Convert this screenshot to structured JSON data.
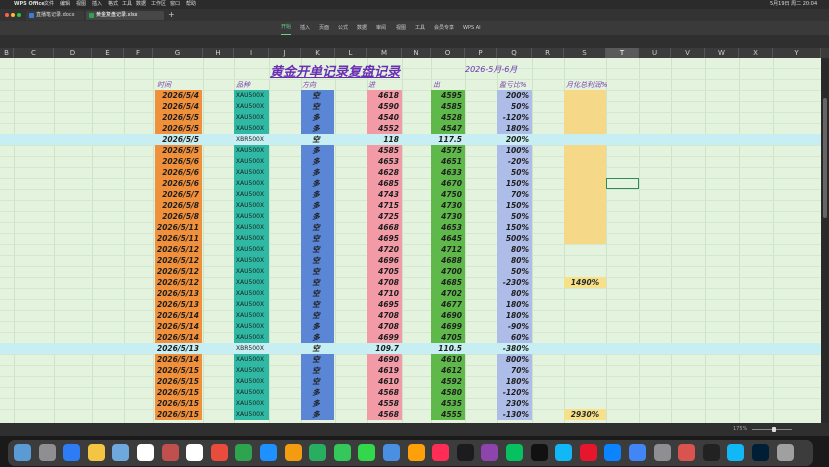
{
  "menubar": {
    "app_name": "WPS Office",
    "items": [
      "文件",
      "编辑",
      "视图",
      "插入",
      "格式",
      "工具",
      "数据",
      "工作区",
      "窗口",
      "帮助"
    ],
    "clock": "5月19日 周二 20:04"
  },
  "tabs": [
    {
      "label": "直播笔记录.docx",
      "color": "#3d7bd9"
    },
    {
      "label": "黄金复盘记录.xlsx",
      "color": "#2ea44f"
    }
  ],
  "ribbon": {
    "items": [
      "开始",
      "插入",
      "页面",
      "公式",
      "数据",
      "审阅",
      "视图",
      "工具",
      "会员专享",
      "WPS AI"
    ],
    "active": "开始"
  },
  "columns": [
    "B",
    "C",
    "D",
    "E",
    "F",
    "G",
    "H",
    "I",
    "J",
    "K",
    "L",
    "M",
    "N",
    "O",
    "P",
    "Q",
    "R",
    "S",
    "T",
    "U",
    "V",
    "W",
    "X",
    "Y"
  ],
  "selected_column": "T",
  "sheet": {
    "title": "黄金开单记录复盘记录",
    "period": "2026-5月-6月",
    "headers": {
      "date": "时间",
      "product": "品种",
      "direction": "方向",
      "entry": "进",
      "exit": "出",
      "profit": "盈亏比%",
      "monthly": "月化总利润%"
    },
    "rows": [
      {
        "date": "2026/5/4",
        "product": "XAU500X",
        "direction": "空",
        "entry": "4618",
        "exit": "4595",
        "profit": "200%"
      },
      {
        "date": "2026/5/4",
        "product": "XAU500X",
        "direction": "空",
        "entry": "4590",
        "exit": "4585",
        "profit": "50%"
      },
      {
        "date": "2026/5/5",
        "product": "XAU500X",
        "direction": "多",
        "entry": "4540",
        "exit": "4528",
        "profit": "-120%"
      },
      {
        "date": "2026/5/5",
        "product": "XAU500X",
        "direction": "多",
        "entry": "4552",
        "exit": "4547",
        "profit": "180%"
      },
      {
        "date": "2026/5/5",
        "product": "XBR500X",
        "direction": "空",
        "entry": "118",
        "exit": "117.5",
        "profit": "200%",
        "special": true
      },
      {
        "date": "2026/5/5",
        "product": "XAU500X",
        "direction": "多",
        "entry": "4585",
        "exit": "4575",
        "profit": "100%"
      },
      {
        "date": "2026/5/6",
        "product": "XAU500X",
        "direction": "多",
        "entry": "4653",
        "exit": "4651",
        "profit": "-20%"
      },
      {
        "date": "2026/5/6",
        "product": "XAU500X",
        "direction": "多",
        "entry": "4628",
        "exit": "4633",
        "profit": "50%"
      },
      {
        "date": "2026/5/6",
        "product": "XAU500X",
        "direction": "多",
        "entry": "4685",
        "exit": "4670",
        "profit": "150%"
      },
      {
        "date": "2026/5/7",
        "product": "XAU500X",
        "direction": "多",
        "entry": "4743",
        "exit": "4750",
        "profit": "70%"
      },
      {
        "date": "2026/5/8",
        "product": "XAU500X",
        "direction": "多",
        "entry": "4715",
        "exit": "4730",
        "profit": "150%"
      },
      {
        "date": "2026/5/8",
        "product": "XAU500X",
        "direction": "多",
        "entry": "4725",
        "exit": "4730",
        "profit": "50%"
      },
      {
        "date": "2026/5/11",
        "product": "XAU500X",
        "direction": "空",
        "entry": "4668",
        "exit": "4653",
        "profit": "150%"
      },
      {
        "date": "2026/5/11",
        "product": "XAU500X",
        "direction": "空",
        "entry": "4695",
        "exit": "4645",
        "profit": "500%"
      },
      {
        "date": "2026/5/12",
        "product": "XAU500X",
        "direction": "空",
        "entry": "4720",
        "exit": "4712",
        "profit": "80%"
      },
      {
        "date": "2026/5/12",
        "product": "XAU500X",
        "direction": "空",
        "entry": "4696",
        "exit": "4688",
        "profit": "80%"
      },
      {
        "date": "2026/5/12",
        "product": "XAU500X",
        "direction": "空",
        "entry": "4705",
        "exit": "4700",
        "profit": "50%"
      },
      {
        "date": "2026/5/12",
        "product": "XAU500X",
        "direction": "空",
        "entry": "4708",
        "exit": "4685",
        "profit": "-230%"
      },
      {
        "date": "2026/5/13",
        "product": "XAU500X",
        "direction": "空",
        "entry": "4710",
        "exit": "4702",
        "profit": "80%"
      },
      {
        "date": "2026/5/13",
        "product": "XAU500X",
        "direction": "空",
        "entry": "4695",
        "exit": "4677",
        "profit": "180%"
      },
      {
        "date": "2026/5/14",
        "product": "XAU500X",
        "direction": "空",
        "entry": "4708",
        "exit": "4690",
        "profit": "180%"
      },
      {
        "date": "2026/5/14",
        "product": "XAU500X",
        "direction": "多",
        "entry": "4708",
        "exit": "4699",
        "profit": "-90%"
      },
      {
        "date": "2026/5/14",
        "product": "XAU500X",
        "direction": "多",
        "entry": "4699",
        "exit": "4705",
        "profit": "60%"
      },
      {
        "date": "2026/5/13",
        "product": "XBR500X",
        "direction": "空",
        "entry": "109.7",
        "exit": "110.5",
        "profit": "-380%",
        "special": true
      },
      {
        "date": "2026/5/14",
        "product": "XAU500X",
        "direction": "空",
        "entry": "4690",
        "exit": "4610",
        "profit": "800%"
      },
      {
        "date": "2026/5/15",
        "product": "XAU500X",
        "direction": "空",
        "entry": "4619",
        "exit": "4612",
        "profit": "70%"
      },
      {
        "date": "2026/5/15",
        "product": "XAU500X",
        "direction": "空",
        "entry": "4610",
        "exit": "4592",
        "profit": "180%"
      },
      {
        "date": "2026/5/15",
        "product": "XAU500X",
        "direction": "多",
        "entry": "4568",
        "exit": "4580",
        "profit": "-120%"
      },
      {
        "date": "2026/5/15",
        "product": "XAU500X",
        "direction": "多",
        "entry": "4558",
        "exit": "4535",
        "profit": "230%"
      },
      {
        "date": "2026/5/15",
        "product": "XAU500X",
        "direction": "多",
        "entry": "4568",
        "exit": "4555",
        "profit": "-130%"
      }
    ],
    "totals": [
      {
        "row_index": 17,
        "value": "1490%"
      },
      {
        "row_index": 29,
        "value": "2930%"
      }
    ]
  },
  "status": {
    "zoom": "175%"
  },
  "colors": {
    "sheet_bg": "#e3f3dd",
    "date_col": "#f0903a",
    "product_col": "#2fb9a4",
    "direction_col": "#5b86d6",
    "entry_col": "#f29aa6",
    "exit_col": "#5fb84a",
    "profit_col": "#aebde8",
    "monthly_col": "#f6d889",
    "special_row": "#c7eff3",
    "title": "#6b2fb5"
  },
  "dock_icons": [
    "finder-icon",
    "launchpad-icon",
    "app-store-icon",
    "notes-icon",
    "folder-icon",
    "calendar-icon",
    "contacts-icon",
    "reminders-icon",
    "wps-icon",
    "excel-icon",
    "finder2-icon",
    "photos-icon",
    "maps-icon",
    "messages-icon",
    "facetime-icon",
    "mail-icon",
    "photo2-icon",
    "music-icon",
    "tv-icon",
    "podcasts-icon",
    "wechat-icon",
    "tiktok-icon",
    "qq-icon",
    "weibo-icon",
    "safari-icon",
    "chrome-icon",
    "settings-icon",
    "wps2-icon",
    "screen-icon",
    "qq2-icon",
    "photoshop-icon",
    "trash-icon"
  ]
}
